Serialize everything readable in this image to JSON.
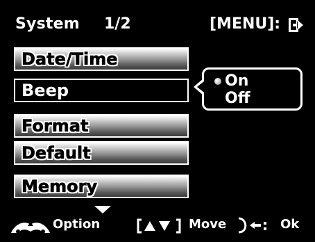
{
  "header": {
    "title": "System",
    "page": "1/2",
    "menu_hint": "[MENU]:"
  },
  "menu": {
    "items": [
      {
        "label": "Date/Time"
      },
      {
        "label": "Beep"
      },
      {
        "label": "Format"
      },
      {
        "label": "Default"
      },
      {
        "label": "Memory"
      }
    ],
    "selected_index": 1
  },
  "popup": {
    "options": [
      {
        "label": "On"
      },
      {
        "label": "Off"
      }
    ],
    "selected_index": 0
  },
  "footer": {
    "option_label": "Option",
    "move_label": "Move",
    "ok_label": "Ok"
  },
  "icons": {
    "exit": "exit-arrow-icon",
    "more_below": "down-arrow-icon",
    "option": "zoom-dial-icon",
    "move": "up-down-bracket-icon",
    "ok": "shutter-return-icon"
  },
  "colors": {
    "background": "#000000",
    "text": "#ffffff"
  }
}
